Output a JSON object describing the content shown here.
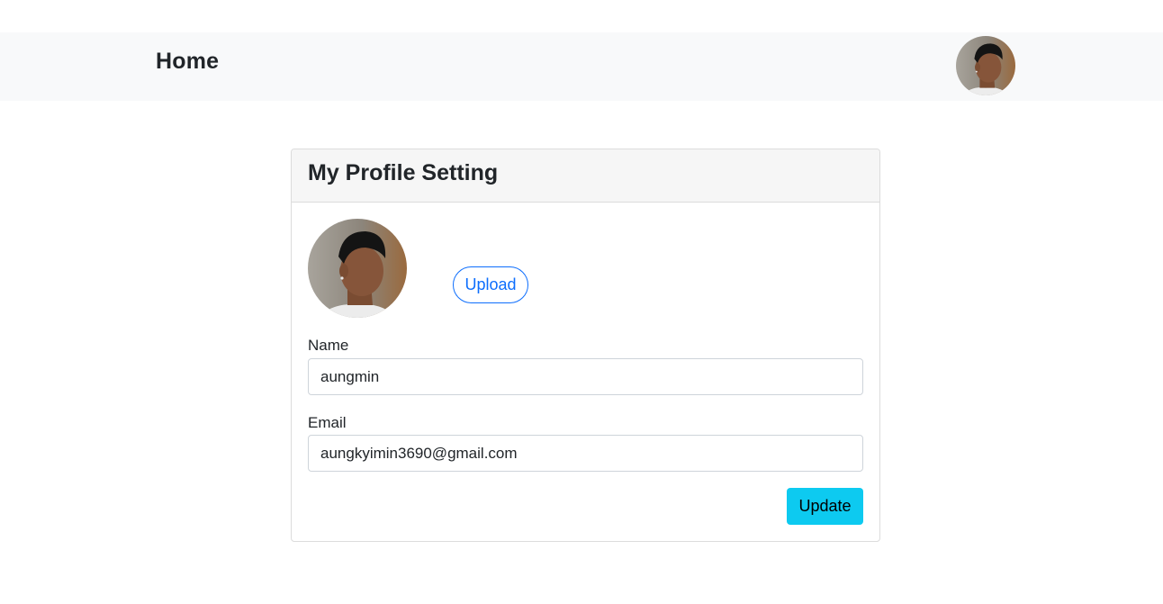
{
  "navbar": {
    "brand": "Home",
    "avatar_alt": "user-avatar"
  },
  "profile_card": {
    "title": "My Profile Setting",
    "upload_label": "Upload",
    "name": {
      "label": "Name",
      "value": "aungmin"
    },
    "email": {
      "label": "Email",
      "value": "aungkyimin3690@gmail.com"
    },
    "update_label": "Update"
  },
  "colors": {
    "navbar_bg": "#f8f9fa",
    "primary": "#0d6efd",
    "info": "#0dcaf0"
  }
}
